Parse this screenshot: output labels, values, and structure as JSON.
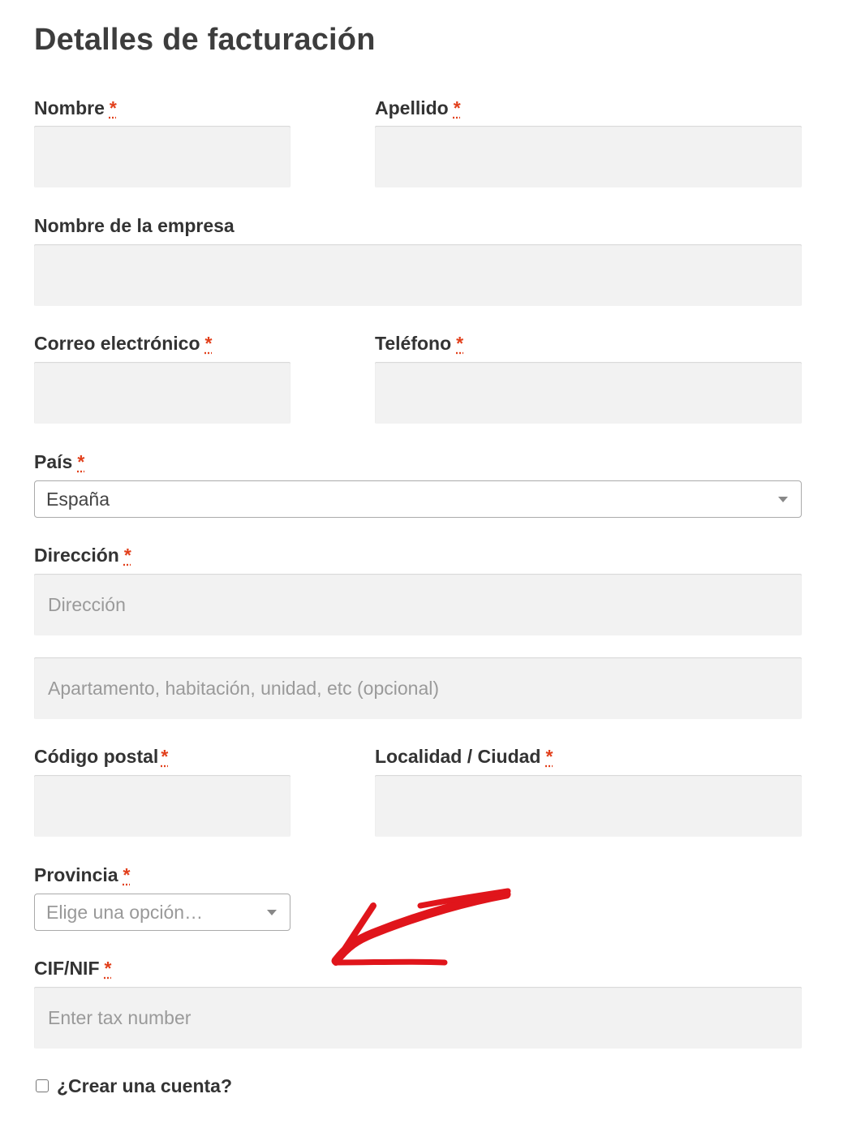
{
  "heading": "Detalles de facturación",
  "required_mark": "*",
  "fields": {
    "first_name": {
      "label": "Nombre",
      "value": ""
    },
    "last_name": {
      "label": "Apellido",
      "value": ""
    },
    "company": {
      "label": "Nombre de la empresa",
      "value": ""
    },
    "email": {
      "label": "Correo electrónico",
      "value": ""
    },
    "phone": {
      "label": "Teléfono",
      "value": ""
    },
    "country": {
      "label": "País",
      "value": "España"
    },
    "address": {
      "label": "Dirección",
      "placeholder_1": "Dirección",
      "placeholder_2": "Apartamento, habitación, unidad, etc (opcional)"
    },
    "postcode": {
      "label": "Código postal",
      "value": ""
    },
    "city": {
      "label": "Localidad / Ciudad",
      "value": ""
    },
    "state": {
      "label": "Provincia",
      "placeholder": "Elige una opción…"
    },
    "tax": {
      "label": "CIF/NIF",
      "placeholder": "Enter tax number"
    }
  },
  "create_account": {
    "label": "¿Crear una cuenta?",
    "checked": false
  },
  "colors": {
    "required": "#e2401c",
    "input_bg": "#f2f2f2",
    "annotation_arrow": "#e0151b"
  },
  "annotation": {
    "icon": "hand-drawn-arrow-icon"
  }
}
